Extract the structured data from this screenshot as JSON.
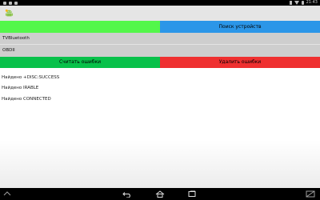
{
  "status_bar": {
    "time": "21:43",
    "icons": [
      "notification-icon",
      "bluetooth-icon",
      "wifi-icon",
      "battery-icon"
    ]
  },
  "app": {
    "icon": "android-robot-icon"
  },
  "buttons": {
    "search_devices": "Поиск устройств",
    "read_errors": "Считать ошибки",
    "delete_errors": "Удалить ошибки"
  },
  "devices": [
    "TVBluetooth",
    "OBDII"
  ],
  "log": [
    "Найдено +DISC:SUCCESS",
    "Найдено IRABLE",
    "Найдено CONNECTED"
  ],
  "nav": {
    "icons": [
      "back-icon",
      "home-icon",
      "recent-apps-icon"
    ]
  },
  "colors": {
    "green_bar": "#53f74a",
    "search_button": "#2b96e8",
    "read_button": "#08c14a",
    "delete_button": "#ef3030",
    "list_item": "#cecece"
  }
}
